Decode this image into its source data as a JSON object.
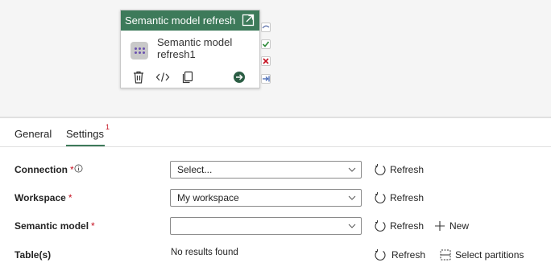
{
  "activity": {
    "header_title": "Semantic model refresh",
    "name_line1": "Semantic model",
    "name_line2": "refresh1"
  },
  "tabs": {
    "general": "General",
    "settings": "Settings",
    "settings_badge": "1"
  },
  "form": {
    "connection": {
      "label": "Connection",
      "required": "*",
      "value": "Select...",
      "refresh": "Refresh"
    },
    "workspace": {
      "label": "Workspace",
      "required": "*",
      "value": "My workspace",
      "refresh": "Refresh"
    },
    "semantic_model": {
      "label": "Semantic model",
      "required": "*",
      "value": "",
      "refresh": "Refresh",
      "new": "New"
    },
    "tables": {
      "label": "Table(s)",
      "value": "No results found",
      "refresh": "Refresh",
      "select_partitions": "Select partitions"
    }
  },
  "colors": {
    "accent": "#3d7a5a",
    "required": "#c50f1f"
  }
}
